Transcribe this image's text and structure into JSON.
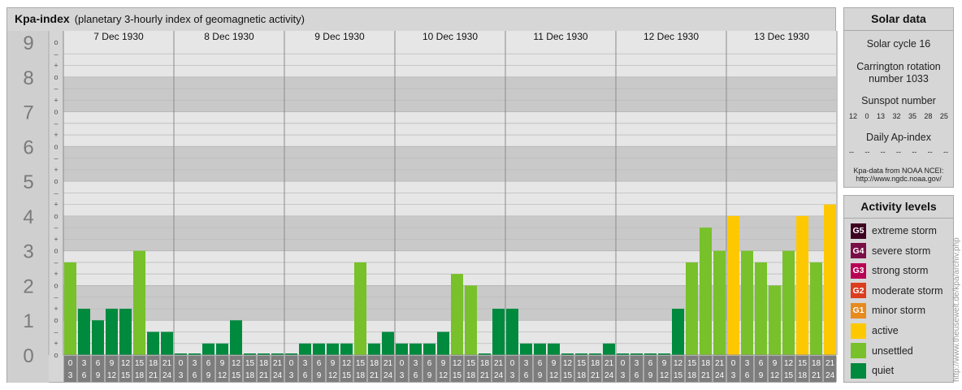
{
  "header": {
    "title": "Kpa-index",
    "subtitle": "(planetary 3-hourly index of geomagnetic activity)"
  },
  "chart_data": {
    "type": "bar",
    "title": "Kpa-index",
    "subtitle": "(planetary 3-hourly index of geomagnetic activity)",
    "ylim": [
      0,
      9
    ],
    "y_ticks": [
      "0",
      "1",
      "2",
      "3",
      "4",
      "5",
      "6",
      "7",
      "8",
      "9"
    ],
    "sub_ticks": [
      "o",
      "+",
      "–"
    ],
    "days": [
      "7 Dec 1930",
      "8 Dec 1930",
      "9 Dec 1930",
      "10 Dec 1930",
      "11 Dec 1930",
      "12 Dec 1930",
      "13 Dec 1930"
    ],
    "interval_start_labels": [
      "0",
      "3",
      "6",
      "9",
      "12",
      "15",
      "18",
      "21"
    ],
    "interval_end_labels": [
      "3",
      "6",
      "9",
      "12",
      "15",
      "18",
      "21",
      "24"
    ],
    "values": [
      [
        2.667,
        1.333,
        1.0,
        1.333,
        1.333,
        3.0,
        0.667,
        0.667
      ],
      [
        0.0,
        0.0,
        0.333,
        0.333,
        1.0,
        0.0,
        0.0,
        0.0
      ],
      [
        0.0,
        0.333,
        0.333,
        0.333,
        0.333,
        2.667,
        0.333,
        0.667
      ],
      [
        0.333,
        0.333,
        0.333,
        0.667,
        2.333,
        2.0,
        0.0,
        1.333
      ],
      [
        1.333,
        0.333,
        0.333,
        0.333,
        0.0,
        0.0,
        0.0,
        0.333
      ],
      [
        0.0,
        0.0,
        0.0,
        0.0,
        1.333,
        2.667,
        3.667,
        3.0
      ],
      [
        4.0,
        3.0,
        2.667,
        2.0,
        3.0,
        4.0,
        2.667,
        4.333
      ]
    ],
    "level_colors": {
      "quiet": "#008a3e",
      "unsettled": "#78c12a",
      "active": "#fec800",
      "G1": "#e88a1e",
      "G2": "#dc3d1e",
      "G3": "#b80054",
      "G4": "#7a0f47",
      "G5": "#3d0022"
    },
    "grid": true,
    "legend": "right"
  },
  "solar_data": {
    "title": "Solar data",
    "solar_cycle": "Solar cycle 16",
    "carrington_line1": "Carrington rotation",
    "carrington_line2": "number 1033",
    "sunspot_label": "Sunspot number",
    "sunspot_values": [
      "12",
      "0",
      "13",
      "32",
      "35",
      "28",
      "25"
    ],
    "ap_label": "Daily Ap-index",
    "ap_values": [
      "--",
      "--",
      "--",
      "--",
      "--",
      "--",
      "--"
    ],
    "source_line1": "Kpa-data from NOAA NCEI:",
    "source_line2": "http://www.ngdc.noaa.gov/"
  },
  "activity_levels": {
    "title": "Activity levels",
    "items": [
      {
        "badge": "G5",
        "label": "extreme storm",
        "color": "#3d0022"
      },
      {
        "badge": "G4",
        "label": "severe storm",
        "color": "#7a0f47"
      },
      {
        "badge": "G3",
        "label": "strong storm",
        "color": "#b80054"
      },
      {
        "badge": "G2",
        "label": "moderate storm",
        "color": "#dc3d1e"
      },
      {
        "badge": "G1",
        "label": "minor storm",
        "color": "#e88a1e"
      },
      {
        "badge": "",
        "label": "active",
        "color": "#fec800"
      },
      {
        "badge": "",
        "label": "unsettled",
        "color": "#78c12a"
      },
      {
        "badge": "",
        "label": "quiet",
        "color": "#008a3e"
      }
    ]
  },
  "watermark": "http://www.theusewelt.de/kpa/archiv.php"
}
